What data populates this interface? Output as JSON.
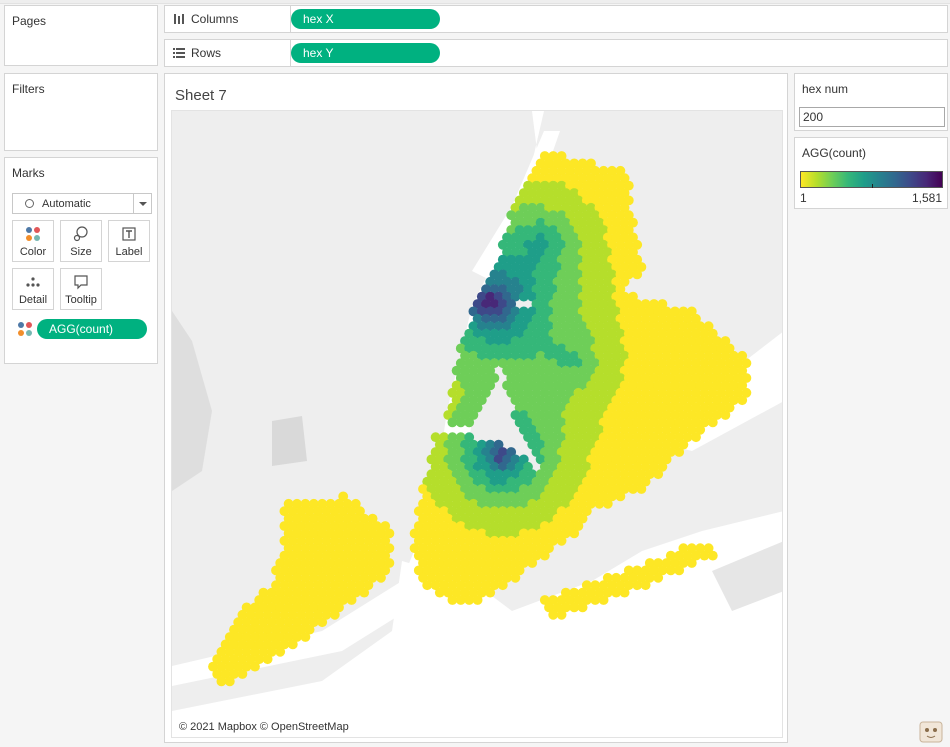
{
  "panels": {
    "pages": {
      "title": "Pages"
    },
    "filters": {
      "title": "Filters"
    },
    "marks": {
      "title": "Marks",
      "mark_type": "Automatic",
      "buttons": [
        {
          "label": "Color",
          "icon": "color-dots-icon"
        },
        {
          "label": "Size",
          "icon": "size-icon"
        },
        {
          "label": "Label",
          "icon": "label-icon"
        },
        {
          "label": "Detail",
          "icon": "detail-icon"
        },
        {
          "label": "Tooltip",
          "icon": "tooltip-icon"
        }
      ],
      "color_field": "AGG(count)"
    }
  },
  "shelves": {
    "columns": {
      "label": "Columns",
      "pill": "hex X"
    },
    "rows": {
      "label": "Rows",
      "pill": "hex Y"
    }
  },
  "sheet": {
    "title": "Sheet 7",
    "attribution": "© 2021 Mapbox © OpenStreetMap"
  },
  "parameter": {
    "title": "hex num",
    "value": "200"
  },
  "legend": {
    "title": "AGG(count)",
    "min_label": "1",
    "max_label": "1,581",
    "colors": [
      "#fde725",
      "#b5de2b",
      "#6ece58",
      "#35b779",
      "#1f9e89",
      "#26828e",
      "#31688e",
      "#3e4989",
      "#482878",
      "#440154"
    ]
  },
  "map": {
    "water_color": "#ffffff",
    "land_color": "#e6e6e6",
    "mark_color_low": "#fde725",
    "mark_color_high": "#440154"
  }
}
